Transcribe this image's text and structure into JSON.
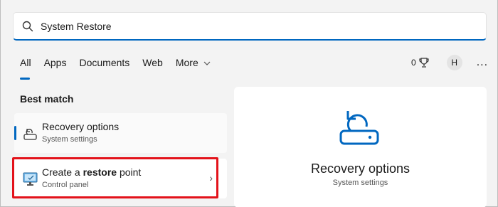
{
  "search": {
    "value": "System Restore"
  },
  "tabs": [
    {
      "label": "All",
      "active": true
    },
    {
      "label": "Apps"
    },
    {
      "label": "Documents"
    },
    {
      "label": "Web"
    },
    {
      "label": "More"
    }
  ],
  "toolbar": {
    "points": "0",
    "avatar_initial": "H",
    "more_label": "..."
  },
  "best_match": {
    "heading": "Best match",
    "items": [
      {
        "title": "Recovery options",
        "subtitle": "System settings",
        "icon": "recovery-icon"
      },
      {
        "title_pre": "Create a ",
        "title_bold": "restore",
        "title_post": " point",
        "subtitle": "Control panel",
        "icon": "monitor-icon",
        "arrow": "›"
      }
    ]
  },
  "preview": {
    "title": "Recovery options",
    "subtitle": "System settings",
    "icon": "recovery-icon"
  },
  "colors": {
    "accent": "#0067c0",
    "highlight": "#e3121a"
  }
}
